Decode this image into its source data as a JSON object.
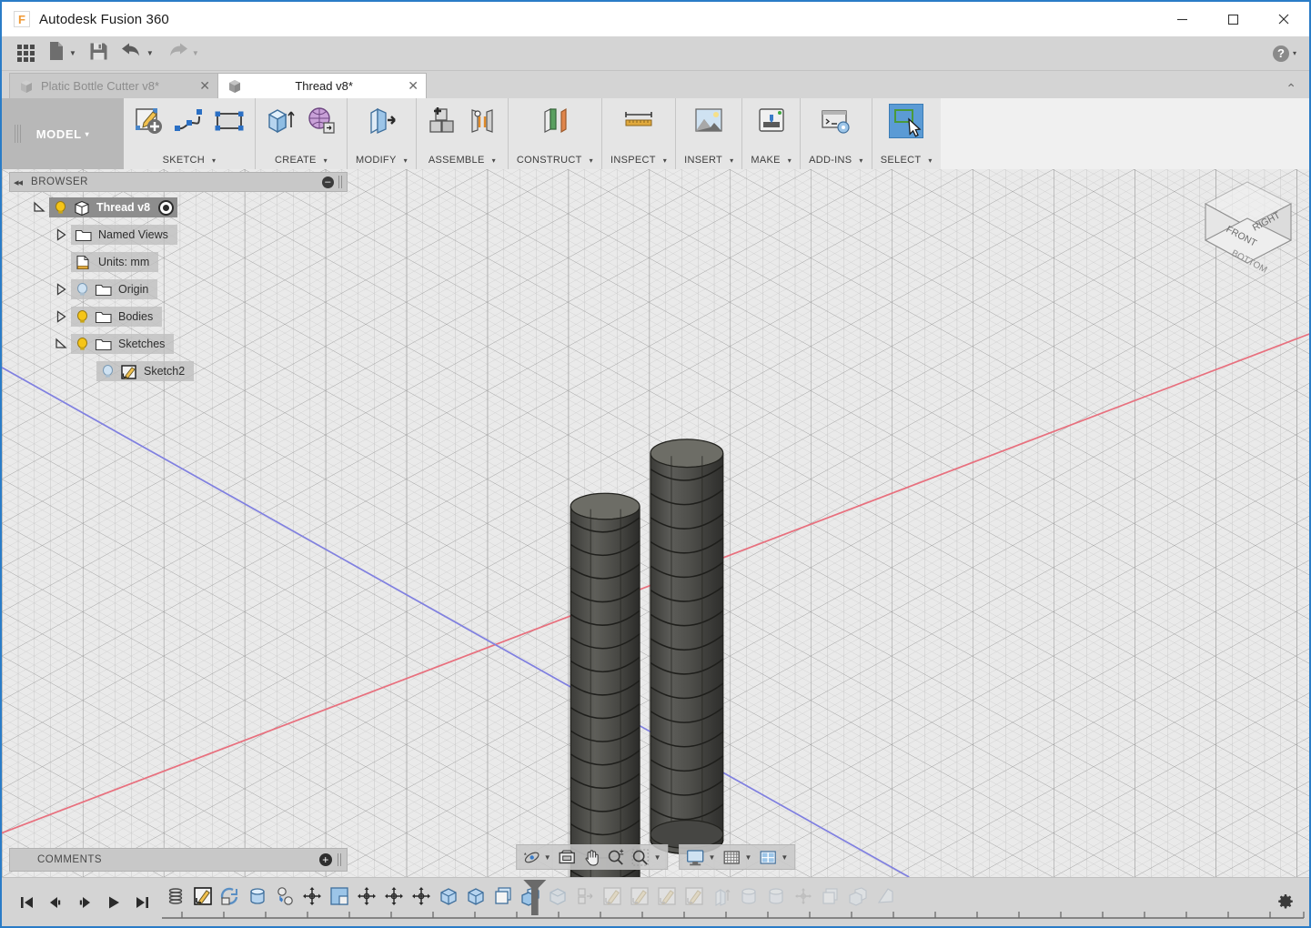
{
  "window": {
    "title": "Autodesk Fusion 360",
    "logo_letter": "F",
    "minimize": "–",
    "maximize": "□",
    "close": "✕"
  },
  "quick_access": {
    "items": [
      {
        "name": "app-grid",
        "label": "",
        "icon": "grid-icon",
        "caret": false
      },
      {
        "name": "new-document",
        "label": "",
        "icon": "new-file-icon",
        "caret": true
      },
      {
        "name": "save",
        "label": "",
        "icon": "save-icon",
        "caret": false
      },
      {
        "name": "undo",
        "label": "",
        "icon": "undo-icon",
        "caret": true
      },
      {
        "name": "redo",
        "label": "",
        "icon": "redo-icon",
        "caret": true
      }
    ],
    "help_label": "?",
    "help_caret": "▾"
  },
  "tabs": {
    "collapse_glyph": "⌃",
    "items": [
      {
        "label": "Platic Bottle Cutter v8*",
        "active": false,
        "close": "✕"
      },
      {
        "label": "Thread v8*",
        "active": true,
        "close": "✕"
      }
    ]
  },
  "ribbon": {
    "workspace": {
      "label": "MODEL",
      "caret": "▾"
    },
    "panels": [
      {
        "label": "SKETCH",
        "caret": "▾",
        "icons": [
          "create-sketch-icon",
          "spline-icon",
          "rectangle-icon"
        ]
      },
      {
        "label": "CREATE",
        "caret": "▾",
        "icons": [
          "extrude-icon",
          "create-form-icon"
        ]
      },
      {
        "label": "MODIFY",
        "caret": "▾",
        "icons": [
          "press-pull-icon"
        ]
      },
      {
        "label": "ASSEMBLE",
        "caret": "▾",
        "icons": [
          "new-component-icon",
          "joint-icon"
        ]
      },
      {
        "label": "CONSTRUCT",
        "caret": "▾",
        "icons": [
          "offset-plane-icon"
        ]
      },
      {
        "label": "INSPECT",
        "caret": "▾",
        "icons": [
          "measure-icon"
        ]
      },
      {
        "label": "INSERT",
        "caret": "▾",
        "icons": [
          "insert-image-icon"
        ]
      },
      {
        "label": "MAKE",
        "caret": "▾",
        "icons": [
          "3d-print-icon"
        ]
      },
      {
        "label": "ADD-INS",
        "caret": "▾",
        "icons": [
          "scripts-addins-icon"
        ]
      },
      {
        "label": "SELECT",
        "caret": "▾",
        "icons": [
          "select-icon"
        ],
        "active": true
      }
    ]
  },
  "browser": {
    "header": {
      "title": "BROWSER",
      "collapse": "◂◂",
      "minus": "–"
    },
    "tree": [
      {
        "label": "Thread v8",
        "depth": 0,
        "expander": "expanded",
        "bulb": "on",
        "icon": "component-icon",
        "root": true,
        "radio": true
      },
      {
        "label": "Named Views",
        "depth": 1,
        "expander": "collapsed",
        "bulb": "none",
        "icon": "folder-icon"
      },
      {
        "label": "Units: mm",
        "depth": 1,
        "expander": "none",
        "bulb": "none",
        "icon": "units-doc-icon"
      },
      {
        "label": "Origin",
        "depth": 1,
        "expander": "collapsed",
        "bulb": "off",
        "icon": "folder-icon"
      },
      {
        "label": "Bodies",
        "depth": 1,
        "expander": "collapsed",
        "bulb": "on",
        "icon": "folder-icon"
      },
      {
        "label": "Sketches",
        "depth": 1,
        "expander": "expanded",
        "bulb": "on",
        "icon": "folder-icon"
      },
      {
        "label": "Sketch2",
        "depth": 2,
        "expander": "none",
        "bulb": "off",
        "icon": "sketch-icon"
      }
    ]
  },
  "comments": {
    "label": "COMMENTS",
    "add": "+"
  },
  "navbar": {
    "group1": [
      {
        "name": "orbit-icon",
        "caret": true
      },
      {
        "name": "look-at-icon",
        "caret": false
      },
      {
        "name": "pan-icon",
        "caret": false
      },
      {
        "name": "zoom-icon",
        "caret": false
      },
      {
        "name": "zoom-window-icon",
        "caret": true
      }
    ],
    "group2": [
      {
        "name": "display-settings-icon",
        "caret": true
      },
      {
        "name": "grid-snaps-icon",
        "caret": true
      },
      {
        "name": "viewports-icon",
        "caret": true
      }
    ]
  },
  "viewcube": {
    "faces": [
      "FRONT",
      "RIGHT",
      "BOTTOM"
    ]
  },
  "viewport": {
    "axes": [
      {
        "name": "x-axis",
        "color": "#e8596b"
      },
      {
        "name": "y-axis",
        "color": "#6b6be8"
      }
    ],
    "bodies": [
      {
        "name": "thread-body-left",
        "label": ""
      },
      {
        "name": "thread-body-right",
        "label": ""
      }
    ],
    "body_color": "#4a4a47",
    "background": "#eaeaea",
    "grid_line_color": "#9a9a9a"
  },
  "timeline": {
    "playback": [
      "skip-to-start-icon",
      "step-back-icon",
      "step-forward-icon",
      "play-icon",
      "skip-to-end-icon"
    ],
    "features": [
      {
        "name": "coil-feature-icon",
        "dim": false
      },
      {
        "name": "sketch-feature-icon",
        "dim": false
      },
      {
        "name": "revolve-feature-icon",
        "dim": false
      },
      {
        "name": "cylinder-feature-icon",
        "dim": false
      },
      {
        "name": "combine-feature-icon",
        "dim": false
      },
      {
        "name": "move-feature-icon",
        "dim": false
      },
      {
        "name": "shell-feature-icon",
        "dim": false
      },
      {
        "name": "move-copy-feature-icon",
        "dim": false
      },
      {
        "name": "move-copy2-feature-icon",
        "dim": false
      },
      {
        "name": "move-copy3-feature-icon",
        "dim": false
      },
      {
        "name": "box-feature-icon",
        "dim": false
      },
      {
        "name": "box2-feature-icon",
        "dim": false
      },
      {
        "name": "pattern-feature-icon",
        "dim": false
      },
      {
        "name": "copy-paste-feature-icon",
        "dim": false
      },
      {
        "name": "box3-feature-icon",
        "dim": true
      },
      {
        "name": "joint-feature-icon",
        "dim": true
      },
      {
        "name": "sketch2-feature-icon",
        "dim": true
      },
      {
        "name": "sketch3-feature-icon",
        "dim": true
      },
      {
        "name": "sketch4-feature-icon",
        "dim": true
      },
      {
        "name": "sketch5-feature-icon",
        "dim": true
      },
      {
        "name": "extrude-feature-icon",
        "dim": true
      },
      {
        "name": "fillet-feature-icon",
        "dim": true
      },
      {
        "name": "fillet2-feature-icon",
        "dim": true
      },
      {
        "name": "move2-feature-icon",
        "dim": true
      },
      {
        "name": "pattern2-feature-icon",
        "dim": true
      },
      {
        "name": "copy2-feature-icon",
        "dim": true
      },
      {
        "name": "mirror-feature-icon",
        "dim": true
      }
    ],
    "playhead_index": 13,
    "settings_icon": "gear-icon"
  }
}
